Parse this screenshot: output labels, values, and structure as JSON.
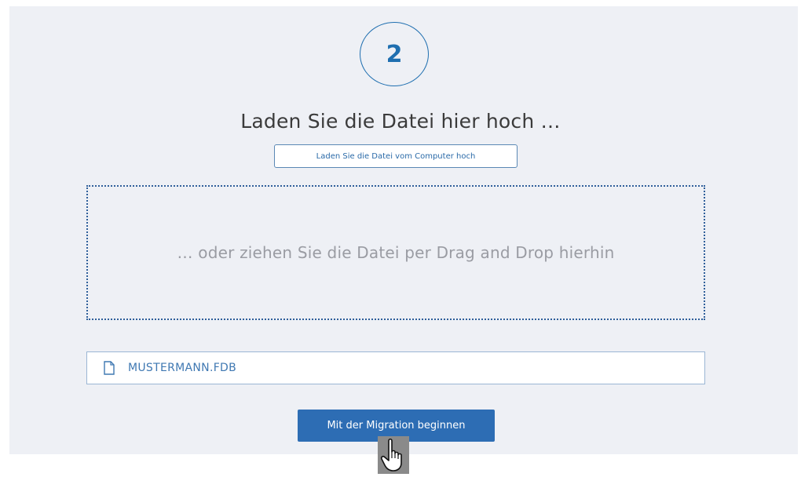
{
  "step": {
    "number": "2"
  },
  "upload": {
    "heading": "Laden Sie die Datei hier hoch …",
    "button_label": "Laden Sie die Datei vom Computer hoch"
  },
  "dropzone": {
    "text": "… oder ziehen Sie die Datei per Drag and Drop hierhin"
  },
  "selected_file": {
    "name": "MUSTERMANN.FDB",
    "icon": "file-icon"
  },
  "actions": {
    "start_label": "Mit der Migration beginnen"
  },
  "colors": {
    "accent": "#2d6db4",
    "panel_background": "#eef0f5",
    "dropzone_border": "#2f5f9a"
  },
  "pointer": {
    "icon": "hand-pointer-cursor-icon"
  }
}
